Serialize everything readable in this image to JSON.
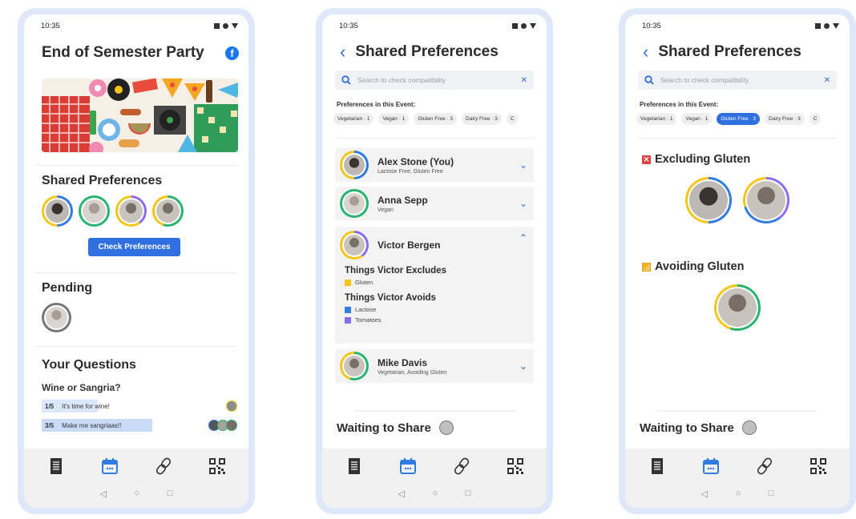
{
  "status": {
    "time": "10:35"
  },
  "screen1": {
    "title": "End of Semester Party",
    "shared_preferences_heading": "Shared Preferences",
    "check_preferences_button": "Check Preferences",
    "pending_heading": "Pending",
    "your_questions_heading": "Your Questions",
    "question": "Wine or Sangria?",
    "answers": [
      {
        "count": "1/5",
        "label": "It's time for wine!",
        "fraction": 0.2
      },
      {
        "count": "3/5",
        "label": "Make me sangriaas!!",
        "fraction": 0.6
      }
    ]
  },
  "screen2": {
    "title": "Shared Preferences",
    "search_placeholder": "Search to check compatibility",
    "prefs_label": "Preferences in this Event:",
    "chips": [
      "Vegetarian · 1",
      "Vegan · 1",
      "Gluten Free · 3",
      "Dairy Free · 3",
      "C"
    ],
    "people": [
      {
        "name": "Alex Stone (You)",
        "sub": "Lactose Free, Gluten Free"
      },
      {
        "name": "Anna Sepp",
        "sub": "Vegan"
      },
      {
        "name": "Victor Bergen",
        "sub": ""
      },
      {
        "name": "Mike Davis",
        "sub": "Vegetarian, Avoiding Gluten"
      }
    ],
    "excludes_heading": "Things Victor Excludes",
    "excludes": [
      "Gluten"
    ],
    "avoids_heading": "Things Victor Avoids",
    "avoids": [
      "Lactose",
      "Tomatoes"
    ],
    "waiting": "Waiting to Share"
  },
  "screen3": {
    "title": "Shared Preferences",
    "search_placeholder": "Search to check compatibility",
    "prefs_label": "Preferences in this Event:",
    "chips": [
      "Vegetarian · 1",
      "Vegan · 1",
      "Gluten Free · 3",
      "Dairy Free · 3",
      "C"
    ],
    "active_chip": 2,
    "excluding_heading": "Excluding Gluten",
    "avoiding_heading": "Avoiding Gluten",
    "waiting": "Waiting to Share"
  },
  "colors": {
    "accent": "#2f6fe0",
    "ring_yellow": "#f5c518",
    "ring_green": "#27b46e",
    "ring_blue": "#2f7de0",
    "ring_purple": "#8c6cf0"
  }
}
